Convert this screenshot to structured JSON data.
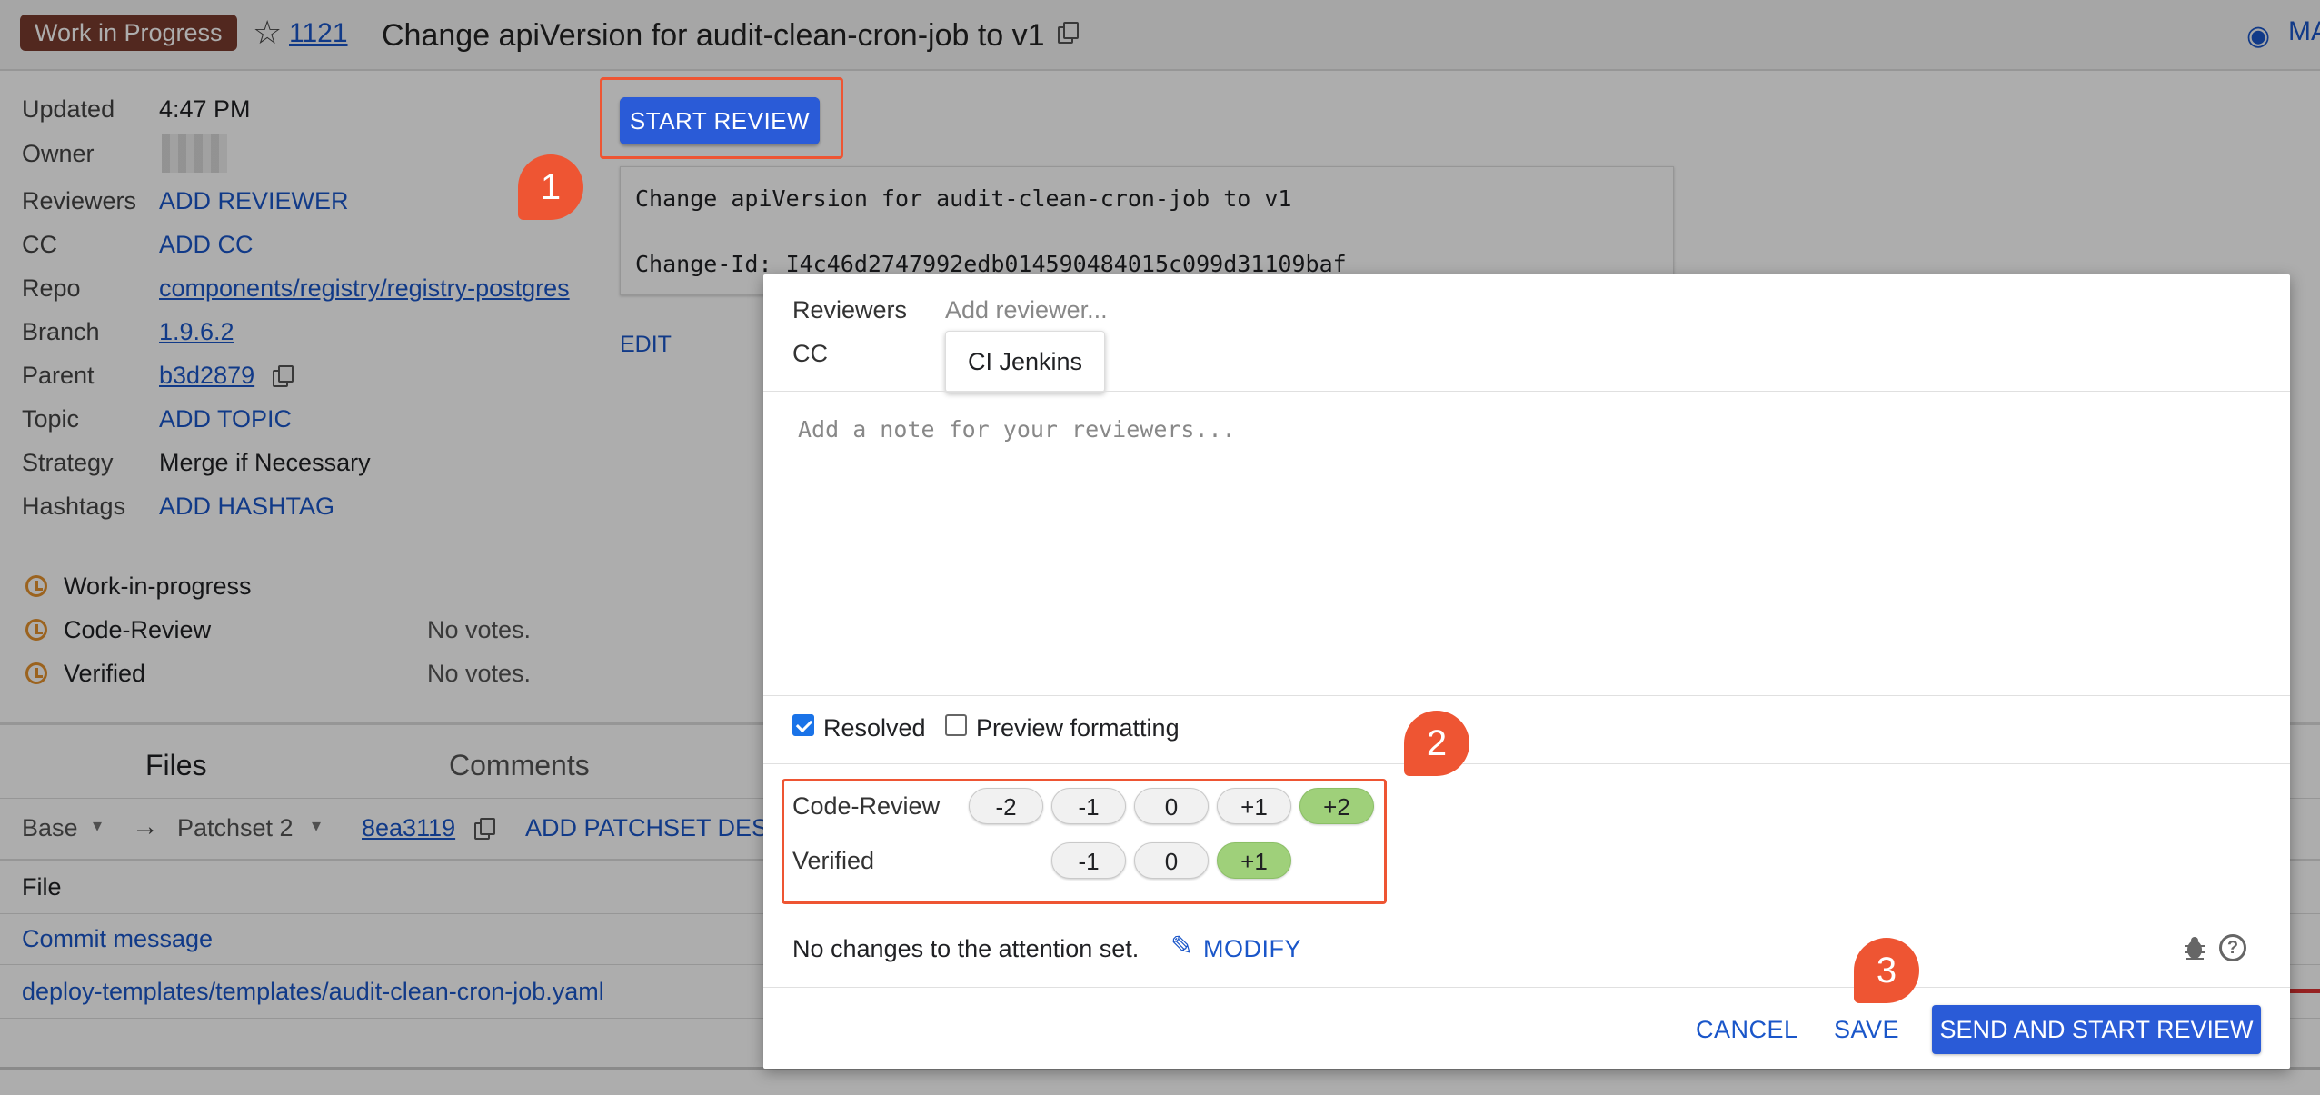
{
  "header": {
    "status_chip": "Work in Progress",
    "change_number": "1121",
    "change_title": "Change apiVersion for audit-clean-cron-job to v1",
    "right_link": "MA"
  },
  "metadata": {
    "updated_label": "Updated",
    "updated_value": "4:47 PM",
    "owner_label": "Owner",
    "reviewers_label": "Reviewers",
    "reviewers_action": "ADD REVIEWER",
    "cc_label": "CC",
    "cc_action": "ADD CC",
    "repo_label": "Repo",
    "repo_value": "components/registry/registry-postgres",
    "branch_label": "Branch",
    "branch_value": "1.9.6.2",
    "parent_label": "Parent",
    "parent_value": "b3d2879",
    "topic_label": "Topic",
    "topic_action": "ADD TOPIC",
    "strategy_label": "Strategy",
    "strategy_value": "Merge if Necessary",
    "hashtags_label": "Hashtags",
    "hashtags_action": "ADD HASHTAG"
  },
  "submit_requirements": [
    {
      "name": "Work-in-progress",
      "status": ""
    },
    {
      "name": "Code-Review",
      "status": "No votes."
    },
    {
      "name": "Verified",
      "status": "No votes."
    }
  ],
  "actions": {
    "start_review": "START REVIEW",
    "edit": "EDIT"
  },
  "commit_message": {
    "line1": "Change apiVersion for audit-clean-cron-job to v1",
    "line2": "Change-Id: I4c46d2747992edb014590484015c099d31109baf"
  },
  "tabs": {
    "files": "Files",
    "comments": "Comments"
  },
  "patchset_bar": {
    "base": "Base",
    "arrow": "→",
    "patchset": "Patchset 2",
    "commit": "8ea3119",
    "add_desc": "ADD PATCHSET DESC"
  },
  "files": {
    "header": "File",
    "rows": [
      "Commit message",
      "deploy-templates/templates/audit-clean-cron-job.yaml"
    ]
  },
  "dialog": {
    "reviewers_label": "Reviewers",
    "reviewer_placeholder": "Add reviewer...",
    "cc_label": "CC",
    "suggestion": "CI Jenkins",
    "note_placeholder": "Add a note for your reviewers...",
    "resolved_label": "Resolved",
    "resolved_checked": true,
    "preview_label": "Preview formatting",
    "preview_checked": false,
    "labels": [
      {
        "name": "Code-Review",
        "options": [
          "-2",
          "-1",
          "0",
          "+1",
          "+2"
        ],
        "highlighted": "+2"
      },
      {
        "name": "Verified",
        "options": [
          "-1",
          "0",
          "+1"
        ],
        "highlighted": "+1"
      }
    ],
    "attention_text": "No changes to the attention set.",
    "modify": "MODIFY",
    "cancel": "CANCEL",
    "save": "SAVE",
    "send": "SEND AND START REVIEW"
  },
  "callouts": [
    "1",
    "2",
    "3"
  ],
  "colors": {
    "accent": "#2a5bd7",
    "link": "#1a56c9",
    "callout": "#ee5533",
    "vote_selected": "#9fd07a",
    "wip_chip": "#7a3b2e"
  }
}
